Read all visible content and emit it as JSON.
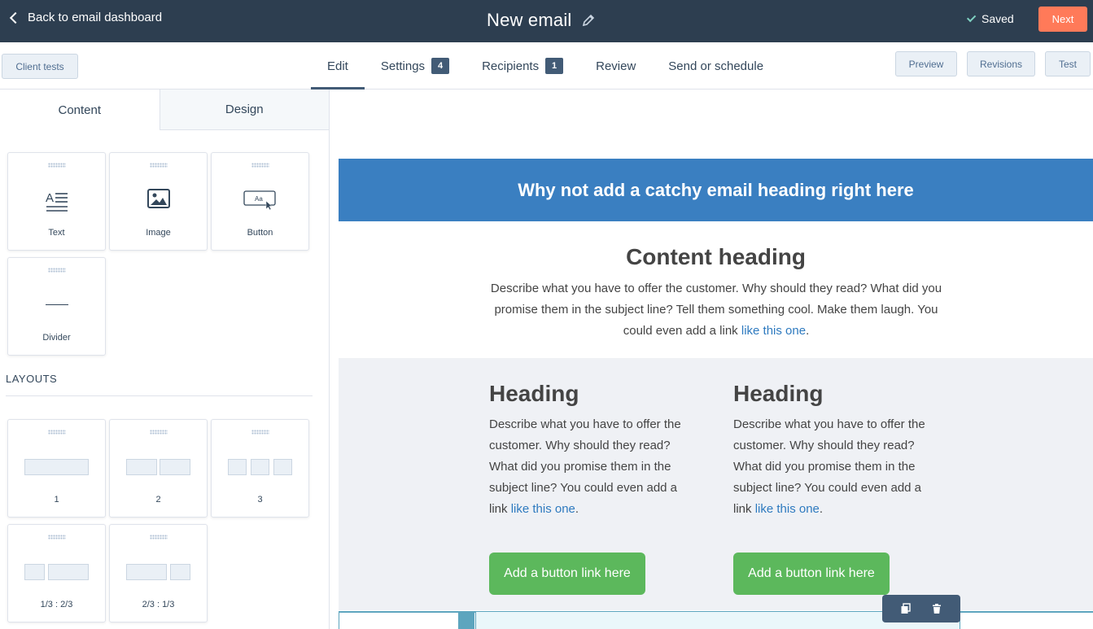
{
  "topbar": {
    "back_label": "Back to email dashboard",
    "title": "New email",
    "saved_label": "Saved",
    "next_label": "Next"
  },
  "subbar": {
    "client_tests_label": "Client tests",
    "tabs": [
      {
        "label": "Edit",
        "active": true
      },
      {
        "label": "Settings",
        "badge": "4"
      },
      {
        "label": "Recipients",
        "badge": "1"
      },
      {
        "label": "Review"
      },
      {
        "label": "Send or schedule"
      }
    ],
    "preview_label": "Preview",
    "revisions_label": "Revisions",
    "test_label": "Test"
  },
  "panel": {
    "tabs": [
      "Content",
      "Design"
    ],
    "content_tiles": [
      "Text",
      "Image",
      "Button",
      "Divider"
    ],
    "layouts_heading": "LAYOUTS",
    "layout_tiles": [
      "1",
      "2",
      "3",
      "1/3 : 2/3",
      "2/3 : 1/3"
    ]
  },
  "canvas": {
    "hero_heading": "Why not add a catchy email heading right here",
    "content_heading": "Content heading",
    "content_text_before": "Describe what you have to offer the customer. Why should they read? What did you promise them in the subject line? Tell them something cool. Make them laugh. You could even add a link ",
    "link_text": "like this one",
    "content_text_after": ".",
    "columns": [
      {
        "heading": "Heading",
        "text": "Describe what you have to offer the customer. Why should they read? What did you promise them in the subject line? You could even add a link ",
        "link": "like this one",
        "after": ".",
        "button": "Add a button link here"
      },
      {
        "heading": "Heading",
        "text": "Describe what you have to offer the customer. Why should they read? What did you promise them in the subject line? You could even add a link ",
        "link": "like this one",
        "after": ".",
        "button": "Add a button link here"
      }
    ]
  },
  "icons": {
    "back": "chevron-left-icon",
    "edit": "pencil-icon",
    "saved": "check-icon",
    "text": "text-icon",
    "image": "image-icon",
    "button": "button-icon",
    "divider": "divider-icon",
    "clone": "clone-icon",
    "delete": "trash-icon"
  },
  "colors": {
    "topbar": "#2d3e50",
    "next": "#ff7a59",
    "hero": "#3a7fc1",
    "cta": "#5cb85c",
    "link": "#2e7abf"
  }
}
